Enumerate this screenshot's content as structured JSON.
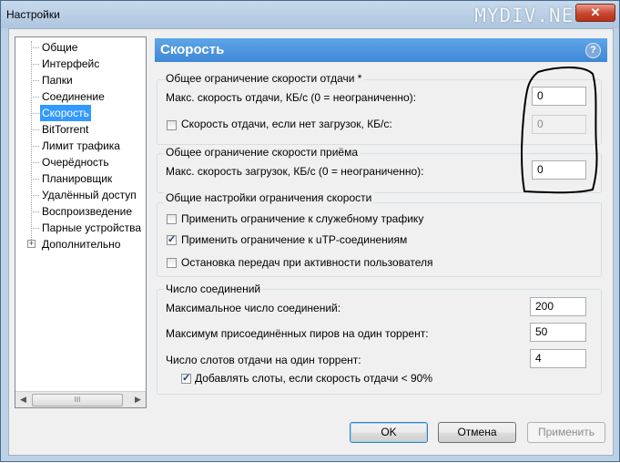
{
  "window": {
    "title": "Настройки",
    "watermark": "MYDIV.NET",
    "close_glyph": "✕"
  },
  "tree": {
    "items": [
      {
        "label": "Общие"
      },
      {
        "label": "Интерфейс"
      },
      {
        "label": "Папки"
      },
      {
        "label": "Соединение"
      },
      {
        "label": "Скорость",
        "selected": true
      },
      {
        "label": "BitTorrent"
      },
      {
        "label": "Лимит трафика"
      },
      {
        "label": "Очерёдность"
      },
      {
        "label": "Планировщик"
      },
      {
        "label": "Удалённый доступ"
      },
      {
        "label": "Воспроизведение"
      },
      {
        "label": "Парные устройства"
      },
      {
        "label": "Дополнительно",
        "expandable": true
      }
    ],
    "expander_glyph": "+",
    "scroll_thumb_grip": "III"
  },
  "header": {
    "title": "Скорость",
    "help_glyph": "?"
  },
  "upload_group": {
    "title": "Общее ограничение скорости отдачи *",
    "max_label": "Макс. скорость отдачи, КБ/с (0 = неограниченно):",
    "max_value": "0",
    "no_download_label": "Скорость отдачи, если нет загрузок, КБ/с:",
    "no_download_checked": false,
    "no_download_value": "0"
  },
  "download_group": {
    "title": "Общее ограничение скорости приёма",
    "max_label": "Макс. скорость загрузок, КБ/с (0 = неограниченно):",
    "max_value": "0"
  },
  "general_group": {
    "title": "Общие настройки ограничения скорости",
    "overhead_label": "Применить ограничение к служебному трафику",
    "overhead_checked": false,
    "utp_label": "Применить ограничение к uTP-соединениям",
    "utp_checked": true,
    "stop_label": "Остановка передач при активности пользователя",
    "stop_checked": false
  },
  "connections_group": {
    "title": "Число соединений",
    "max_conn_label": "Максимальное число соединений:",
    "max_conn_value": "200",
    "max_peers_label": "Максимум присоединённых пиров на один торрент:",
    "max_peers_value": "50",
    "slots_label": "Число слотов отдачи на один торрент:",
    "slots_value": "4",
    "extra_slots_label": "Добавлять слоты, если скорость отдачи < 90%",
    "extra_slots_checked": true
  },
  "buttons": {
    "ok": "OK",
    "cancel": "Отмена",
    "apply": "Применить"
  }
}
